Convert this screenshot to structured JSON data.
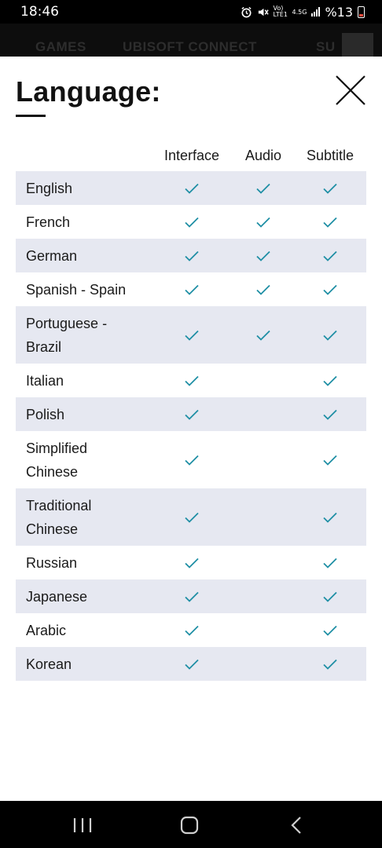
{
  "status_bar": {
    "time": "18:46",
    "network": "Vo) LTE1",
    "network_type": "4.5G",
    "battery": "%13",
    "icons": [
      "alarm-icon",
      "mute-icon",
      "signal-icon",
      "battery-icon"
    ]
  },
  "background_nav": {
    "games": "GAMES",
    "ubisoft_connect": "UBISOFT CONNECT",
    "partial": "SU"
  },
  "modal": {
    "title": "Language:",
    "close_icon": "close-icon",
    "columns": {
      "interface": "Interface",
      "audio": "Audio",
      "subtitle": "Subtitle"
    },
    "check_color": "#1f8fa5",
    "row_shade_color": "#e6e8f1",
    "languages": [
      {
        "name": "English",
        "interface": true,
        "audio": true,
        "subtitle": true
      },
      {
        "name": "French",
        "interface": true,
        "audio": true,
        "subtitle": true
      },
      {
        "name": "German",
        "interface": true,
        "audio": true,
        "subtitle": true
      },
      {
        "name": "Spanish - Spain",
        "interface": true,
        "audio": true,
        "subtitle": true
      },
      {
        "name": "Portuguese - Brazil",
        "interface": true,
        "audio": true,
        "subtitle": true
      },
      {
        "name": "Italian",
        "interface": true,
        "audio": false,
        "subtitle": true
      },
      {
        "name": "Polish",
        "interface": true,
        "audio": false,
        "subtitle": true
      },
      {
        "name": "Simplified Chinese",
        "interface": true,
        "audio": false,
        "subtitle": true
      },
      {
        "name": "Traditional Chinese",
        "interface": true,
        "audio": false,
        "subtitle": true
      },
      {
        "name": "Russian",
        "interface": true,
        "audio": false,
        "subtitle": true
      },
      {
        "name": "Japanese",
        "interface": true,
        "audio": false,
        "subtitle": true
      },
      {
        "name": "Arabic",
        "interface": true,
        "audio": false,
        "subtitle": true
      },
      {
        "name": "Korean",
        "interface": true,
        "audio": false,
        "subtitle": true
      }
    ]
  },
  "nav_bar": {
    "buttons": [
      "recents-icon",
      "home-icon",
      "back-icon"
    ]
  }
}
